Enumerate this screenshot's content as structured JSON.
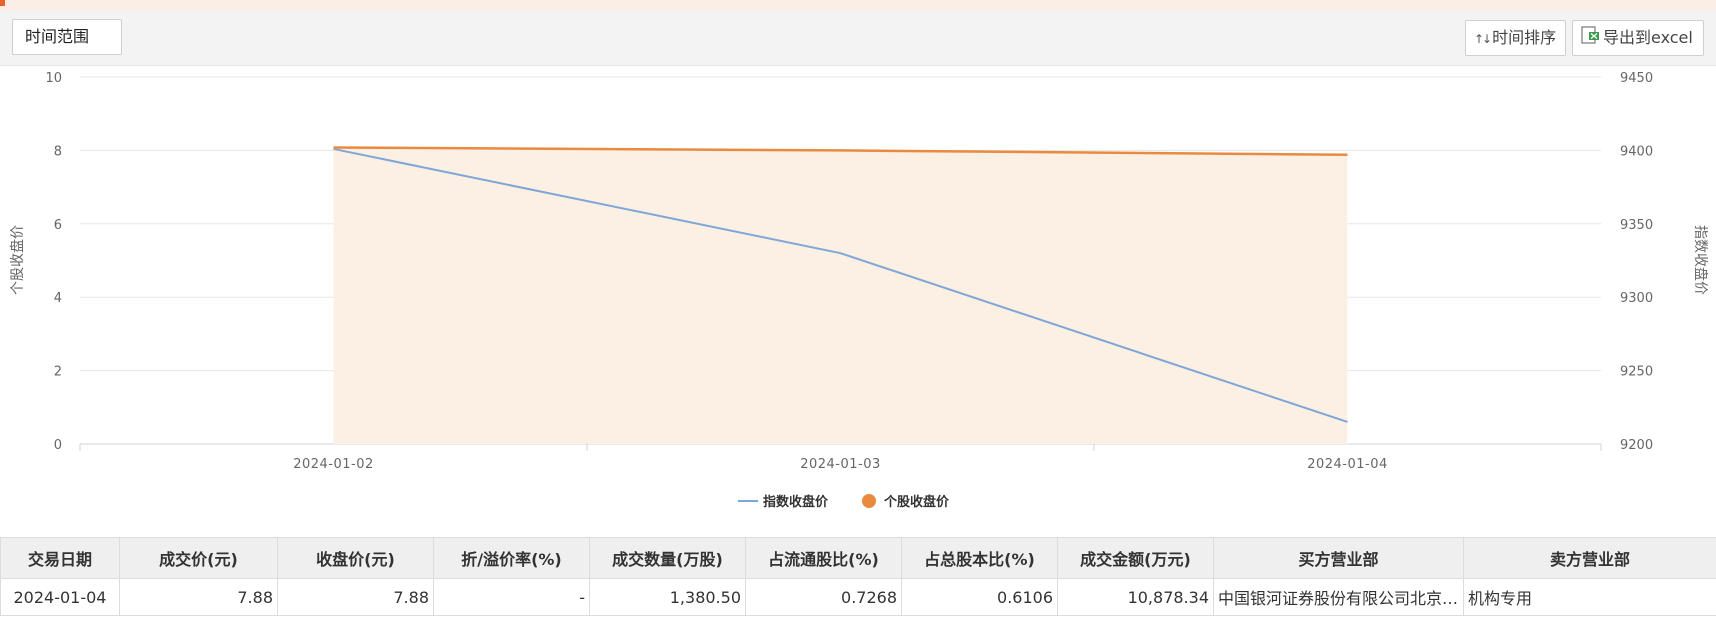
{
  "toolbar": {
    "time_range_label": "时间范围",
    "sort_label": "时间排序",
    "export_label": "导出到excel"
  },
  "chart_data": {
    "type": "line",
    "categories": [
      "2024-01-02",
      "2024-01-03",
      "2024-01-04"
    ],
    "y_left": {
      "label": "个股收盘价",
      "range": [
        0,
        10
      ],
      "ticks": [
        "0",
        "2",
        "4",
        "6",
        "8",
        "10"
      ]
    },
    "y_right": {
      "label": "指数收盘价",
      "range": [
        9200,
        9450
      ],
      "ticks": [
        "9200",
        "9250",
        "9300",
        "9350",
        "9400",
        "9450"
      ]
    },
    "series": [
      {
        "name": "指数收盘价",
        "axis": "right",
        "color": "#7ea6d6",
        "values": [
          9401,
          9330,
          9215
        ]
      },
      {
        "name": "个股收盘价",
        "axis": "left",
        "color": "#e98a3f",
        "fill": "#fcefe4",
        "values": [
          8.08,
          8.0,
          7.88
        ]
      }
    ],
    "grid": true,
    "legend_position": "bottom-center"
  },
  "table": {
    "headers": [
      "交易日期",
      "成交价(元)",
      "收盘价(元)",
      "折/溢价率(%)",
      "成交数量(万股)",
      "占流通股比(%)",
      "占总股本比(%)",
      "成交金额(万元)",
      "买方营业部",
      "卖方营业部"
    ],
    "rows": [
      [
        "2024-01-04",
        "7.88",
        "7.88",
        "-",
        "1,380.50",
        "0.7268",
        "0.6106",
        "10,878.34",
        "中国银河证券股份有限公司北京中关村大街证券营业部",
        "机构专用"
      ]
    ]
  }
}
